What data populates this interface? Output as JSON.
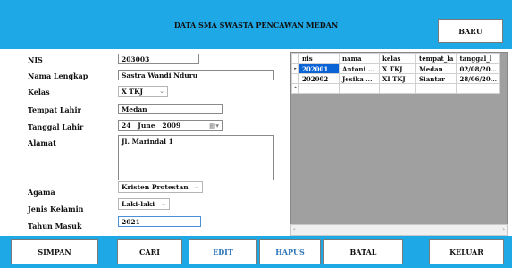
{
  "header": {
    "title": "DATA SMA SWASTA PENCAWAN MEDAN",
    "baru_label": "BARU"
  },
  "form": {
    "nis_label": "NIS",
    "nis_value": "203003",
    "nama_label": "Nama Lengkap",
    "nama_value": "Sastra Wandi Nduru",
    "kelas_label": "Kelas",
    "kelas_value": "X TKJ",
    "tempat_label": "Tempat Lahir",
    "tempat_value": "Medan",
    "tanggal_label": "Tanggal Lahir",
    "tanggal_day": "24",
    "tanggal_month": "June",
    "tanggal_year": "2009",
    "alamat_label": "Alamat",
    "alamat_value": "Jl. Marindal 1",
    "agama_label": "Agama",
    "agama_value": "Kristen Protestan",
    "jk_label": "Jenis Kelamin",
    "jk_value": "Laki-laki",
    "tahun_label": "Tahun Masuk",
    "tahun_value": "2021"
  },
  "grid": {
    "columns": [
      "nis",
      "nama",
      "kelas",
      "tempat_la",
      "tanggal_l"
    ],
    "rows": [
      [
        "202001",
        "Antoni ...",
        "X TKJ",
        "Medan",
        "02/08/20..."
      ],
      [
        "202002",
        "Jesika ...",
        "XI TKJ",
        "Siantar",
        "28/06/20..."
      ]
    ],
    "row_marker": "▸",
    "new_row_marker": "*"
  },
  "footer": {
    "simpan": "SIMPAN",
    "cari": "CARI",
    "edit": "EDIT",
    "hapus": "HAPUS",
    "batal": "BATAL",
    "keluar": "KELUAR"
  },
  "colors": {
    "header_bg": "#1ea8e6",
    "selection": "#0a64d6"
  }
}
